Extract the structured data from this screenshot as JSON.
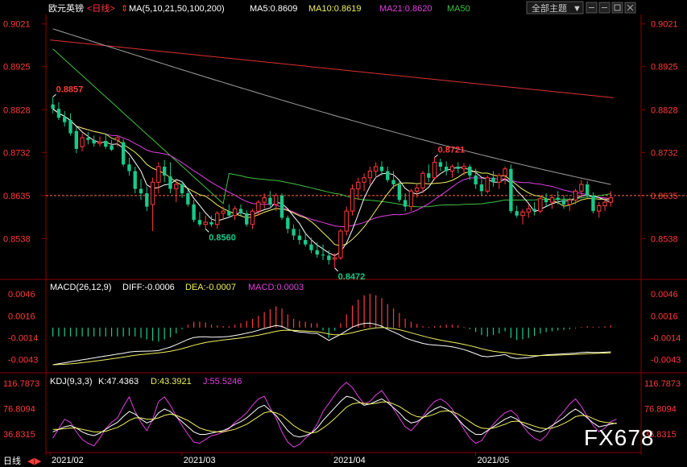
{
  "header": {
    "symbol": "欧元英镑",
    "period_tag": "<日线>",
    "ma_label": "MA(5,10,21,50,100,200)",
    "ma5": "MA5:0.8609",
    "ma10": "MA10:0.8619",
    "ma21": "MA21:0.8620",
    "ma50": "MA50",
    "theme_button": "全部主题",
    "theme_arrow": "▼"
  },
  "colors": {
    "up": "#ff3b3b",
    "down": "#19c98a",
    "price_label": "#ff3b3b",
    "ma5": "#ffffff",
    "ma10": "#f0f060",
    "ma21": "#e040e0",
    "ma50": "#40c040",
    "ma100": "#a0a0a0",
    "ma200": "#e03030",
    "grid": "#8b0000",
    "macd_label": "#ffffff",
    "dea": "#f0f060",
    "macdc": "#e040e0"
  },
  "price_axis": {
    "ticks": [
      "0.9021",
      "0.8925",
      "0.8828",
      "0.8732",
      "0.8635",
      "0.8538"
    ],
    "current_level": 0.8635,
    "annotations": [
      {
        "text": "0.8857",
        "value": 0.8857,
        "color": "#ff3b3b"
      },
      {
        "text": "0.8721",
        "value": 0.8721,
        "color": "#ff3b3b"
      },
      {
        "text": "0.8560",
        "value": 0.856,
        "color": "#19c98a"
      },
      {
        "text": "0.8472",
        "value": 0.8472,
        "color": "#19c98a"
      }
    ]
  },
  "macd": {
    "title": "MACD(26,12,9)",
    "diff": "DIFF:-0.0006",
    "dea": "DEA:-0.0007",
    "macd": "MACD:0.0003",
    "ticks": [
      "0.0046",
      "0.0016",
      "-0.0014",
      "-0.0043"
    ]
  },
  "kdj": {
    "title": "KDJ(9,3,3)",
    "k": "K:47.4363",
    "d": "D:43.3921",
    "j": "J:55.5246",
    "ticks": [
      "116.7873",
      "76.8094",
      "36.8315"
    ],
    "right_ticks": [
      "116.7873",
      "76.8094",
      "36.8315"
    ]
  },
  "time_axis": {
    "labels": [
      "2021/02",
      "2021/03",
      "2021/04",
      "2021/05"
    ]
  },
  "footer": {
    "period_button": "日线",
    "watermark": "FX678"
  },
  "chart_data": {
    "type": "candlestick",
    "instrument": "欧元英镑",
    "period": "日线",
    "price_range": [
      0.845,
      0.9035
    ],
    "candles": [
      {
        "o": 0.884,
        "h": 0.8857,
        "l": 0.882,
        "c": 0.883
      },
      {
        "o": 0.883,
        "h": 0.8845,
        "l": 0.8805,
        "c": 0.881
      },
      {
        "o": 0.8812,
        "h": 0.8825,
        "l": 0.879,
        "c": 0.88
      },
      {
        "o": 0.8805,
        "h": 0.882,
        "l": 0.877,
        "c": 0.8775
      },
      {
        "o": 0.878,
        "h": 0.879,
        "l": 0.873,
        "c": 0.874
      },
      {
        "o": 0.8745,
        "h": 0.8775,
        "l": 0.8735,
        "c": 0.8765
      },
      {
        "o": 0.8765,
        "h": 0.8778,
        "l": 0.875,
        "c": 0.876
      },
      {
        "o": 0.876,
        "h": 0.877,
        "l": 0.8745,
        "c": 0.8752
      },
      {
        "o": 0.8752,
        "h": 0.8768,
        "l": 0.8745,
        "c": 0.8755
      },
      {
        "o": 0.8758,
        "h": 0.8775,
        "l": 0.874,
        "c": 0.8745
      },
      {
        "o": 0.8748,
        "h": 0.876,
        "l": 0.8735,
        "c": 0.8738
      },
      {
        "o": 0.876,
        "h": 0.877,
        "l": 0.8745,
        "c": 0.8765
      },
      {
        "o": 0.8755,
        "h": 0.8762,
        "l": 0.87,
        "c": 0.8705
      },
      {
        "o": 0.8705,
        "h": 0.872,
        "l": 0.868,
        "c": 0.869
      },
      {
        "o": 0.869,
        "h": 0.87,
        "l": 0.864,
        "c": 0.865
      },
      {
        "o": 0.865,
        "h": 0.8672,
        "l": 0.8625,
        "c": 0.864
      },
      {
        "o": 0.864,
        "h": 0.8655,
        "l": 0.86,
        "c": 0.861
      },
      {
        "o": 0.8615,
        "h": 0.8675,
        "l": 0.8555,
        "c": 0.8665
      },
      {
        "o": 0.8665,
        "h": 0.871,
        "l": 0.864,
        "c": 0.87
      },
      {
        "o": 0.87,
        "h": 0.8715,
        "l": 0.8665,
        "c": 0.868
      },
      {
        "o": 0.8678,
        "h": 0.871,
        "l": 0.864,
        "c": 0.865
      },
      {
        "o": 0.865,
        "h": 0.867,
        "l": 0.862,
        "c": 0.866
      },
      {
        "o": 0.866,
        "h": 0.8668,
        "l": 0.863,
        "c": 0.864
      },
      {
        "o": 0.864,
        "h": 0.8648,
        "l": 0.861,
        "c": 0.8615
      },
      {
        "o": 0.8615,
        "h": 0.8625,
        "l": 0.8575,
        "c": 0.858
      },
      {
        "o": 0.858,
        "h": 0.8598,
        "l": 0.8565,
        "c": 0.857
      },
      {
        "o": 0.857,
        "h": 0.859,
        "l": 0.856,
        "c": 0.8575
      },
      {
        "o": 0.8575,
        "h": 0.859,
        "l": 0.8565,
        "c": 0.857
      },
      {
        "o": 0.857,
        "h": 0.86,
        "l": 0.856,
        "c": 0.8595
      },
      {
        "o": 0.8595,
        "h": 0.861,
        "l": 0.858,
        "c": 0.86
      },
      {
        "o": 0.86,
        "h": 0.8615,
        "l": 0.8585,
        "c": 0.859
      },
      {
        "o": 0.859,
        "h": 0.8612,
        "l": 0.858,
        "c": 0.8605
      },
      {
        "o": 0.8605,
        "h": 0.8615,
        "l": 0.859,
        "c": 0.8595
      },
      {
        "o": 0.8595,
        "h": 0.8602,
        "l": 0.8565,
        "c": 0.857
      },
      {
        "o": 0.857,
        "h": 0.8605,
        "l": 0.856,
        "c": 0.86
      },
      {
        "o": 0.86,
        "h": 0.8625,
        "l": 0.859,
        "c": 0.862
      },
      {
        "o": 0.862,
        "h": 0.864,
        "l": 0.8605,
        "c": 0.863
      },
      {
        "o": 0.863,
        "h": 0.8645,
        "l": 0.861,
        "c": 0.8615
      },
      {
        "o": 0.8615,
        "h": 0.864,
        "l": 0.86,
        "c": 0.8635
      },
      {
        "o": 0.8635,
        "h": 0.864,
        "l": 0.858,
        "c": 0.8585
      },
      {
        "o": 0.8585,
        "h": 0.859,
        "l": 0.855,
        "c": 0.856
      },
      {
        "o": 0.856,
        "h": 0.857,
        "l": 0.8535,
        "c": 0.8545
      },
      {
        "o": 0.8545,
        "h": 0.856,
        "l": 0.8525,
        "c": 0.8535
      },
      {
        "o": 0.8535,
        "h": 0.855,
        "l": 0.852,
        "c": 0.8525
      },
      {
        "o": 0.8525,
        "h": 0.854,
        "l": 0.8505,
        "c": 0.8512
      },
      {
        "o": 0.8512,
        "h": 0.853,
        "l": 0.8495,
        "c": 0.8502
      },
      {
        "o": 0.8502,
        "h": 0.8525,
        "l": 0.849,
        "c": 0.85
      },
      {
        "o": 0.85,
        "h": 0.8512,
        "l": 0.848,
        "c": 0.849
      },
      {
        "o": 0.8492,
        "h": 0.8505,
        "l": 0.8472,
        "c": 0.8495
      },
      {
        "o": 0.8495,
        "h": 0.856,
        "l": 0.849,
        "c": 0.8555
      },
      {
        "o": 0.8555,
        "h": 0.861,
        "l": 0.8545,
        "c": 0.86
      },
      {
        "o": 0.86,
        "h": 0.866,
        "l": 0.859,
        "c": 0.865
      },
      {
        "o": 0.865,
        "h": 0.8675,
        "l": 0.8625,
        "c": 0.8665
      },
      {
        "o": 0.8665,
        "h": 0.8685,
        "l": 0.8645,
        "c": 0.8675
      },
      {
        "o": 0.8675,
        "h": 0.87,
        "l": 0.866,
        "c": 0.869
      },
      {
        "o": 0.869,
        "h": 0.871,
        "l": 0.8675,
        "c": 0.87
      },
      {
        "o": 0.87,
        "h": 0.8712,
        "l": 0.868,
        "c": 0.869
      },
      {
        "o": 0.869,
        "h": 0.87,
        "l": 0.8665,
        "c": 0.867
      },
      {
        "o": 0.867,
        "h": 0.869,
        "l": 0.865,
        "c": 0.866
      },
      {
        "o": 0.866,
        "h": 0.8668,
        "l": 0.862,
        "c": 0.8625
      },
      {
        "o": 0.8625,
        "h": 0.864,
        "l": 0.86,
        "c": 0.861
      },
      {
        "o": 0.861,
        "h": 0.865,
        "l": 0.86,
        "c": 0.8645
      },
      {
        "o": 0.8645,
        "h": 0.866,
        "l": 0.863,
        "c": 0.8652
      },
      {
        "o": 0.8652,
        "h": 0.869,
        "l": 0.864,
        "c": 0.8685
      },
      {
        "o": 0.8685,
        "h": 0.8705,
        "l": 0.8665,
        "c": 0.8675
      },
      {
        "o": 0.8675,
        "h": 0.8721,
        "l": 0.867,
        "c": 0.871
      },
      {
        "o": 0.871,
        "h": 0.8718,
        "l": 0.869,
        "c": 0.87
      },
      {
        "o": 0.87,
        "h": 0.8712,
        "l": 0.868,
        "c": 0.869
      },
      {
        "o": 0.869,
        "h": 0.8705,
        "l": 0.8675,
        "c": 0.87
      },
      {
        "o": 0.87,
        "h": 0.871,
        "l": 0.8685,
        "c": 0.8695
      },
      {
        "o": 0.8695,
        "h": 0.8708,
        "l": 0.868,
        "c": 0.87
      },
      {
        "o": 0.87,
        "h": 0.8705,
        "l": 0.867,
        "c": 0.868
      },
      {
        "o": 0.868,
        "h": 0.8695,
        "l": 0.865,
        "c": 0.866
      },
      {
        "o": 0.866,
        "h": 0.8672,
        "l": 0.8635,
        "c": 0.8645
      },
      {
        "o": 0.8645,
        "h": 0.868,
        "l": 0.864,
        "c": 0.8675
      },
      {
        "o": 0.8675,
        "h": 0.869,
        "l": 0.8655,
        "c": 0.8665
      },
      {
        "o": 0.8665,
        "h": 0.8685,
        "l": 0.865,
        "c": 0.868
      },
      {
        "o": 0.868,
        "h": 0.87,
        "l": 0.866,
        "c": 0.8695
      },
      {
        "o": 0.8695,
        "h": 0.8705,
        "l": 0.8595,
        "c": 0.86
      },
      {
        "o": 0.86,
        "h": 0.8612,
        "l": 0.8585,
        "c": 0.859
      },
      {
        "o": 0.859,
        "h": 0.8605,
        "l": 0.857,
        "c": 0.8598
      },
      {
        "o": 0.8598,
        "h": 0.8615,
        "l": 0.8585,
        "c": 0.8605
      },
      {
        "o": 0.8605,
        "h": 0.862,
        "l": 0.859,
        "c": 0.86
      },
      {
        "o": 0.86,
        "h": 0.8635,
        "l": 0.8595,
        "c": 0.8628
      },
      {
        "o": 0.8628,
        "h": 0.864,
        "l": 0.861,
        "c": 0.862
      },
      {
        "o": 0.862,
        "h": 0.8638,
        "l": 0.8605,
        "c": 0.863
      },
      {
        "o": 0.863,
        "h": 0.8645,
        "l": 0.8615,
        "c": 0.8625
      },
      {
        "o": 0.8625,
        "h": 0.8635,
        "l": 0.8605,
        "c": 0.8615
      },
      {
        "o": 0.8615,
        "h": 0.863,
        "l": 0.86,
        "c": 0.8625
      },
      {
        "o": 0.8625,
        "h": 0.865,
        "l": 0.8615,
        "c": 0.8645
      },
      {
        "o": 0.8645,
        "h": 0.867,
        "l": 0.863,
        "c": 0.866
      },
      {
        "o": 0.866,
        "h": 0.8668,
        "l": 0.863,
        "c": 0.8635
      },
      {
        "o": 0.8635,
        "h": 0.8642,
        "l": 0.8595,
        "c": 0.86
      },
      {
        "o": 0.86,
        "h": 0.862,
        "l": 0.8585,
        "c": 0.8612
      },
      {
        "o": 0.8612,
        "h": 0.863,
        "l": 0.86,
        "c": 0.862
      },
      {
        "o": 0.862,
        "h": 0.8645,
        "l": 0.861,
        "c": 0.863
      }
    ],
    "ma_lines": {
      "ma100": {
        "start": 0.901,
        "end": 0.866
      },
      "ma200": {
        "start": 0.8985,
        "end": 0.8855
      }
    },
    "macd_hist": [
      -0.0012,
      -0.0012,
      -0.0012,
      -0.0012,
      -0.0012,
      -0.0012,
      -0.0012,
      -0.0012,
      -0.0012,
      -0.0012,
      -0.0012,
      -0.0012,
      -0.0012,
      -0.0011,
      -0.0012,
      -0.0014,
      -0.0016,
      -0.0018,
      -0.0019,
      -0.0016,
      -0.0013,
      -0.0008,
      -0.0002,
      0.0004,
      0.0008,
      0.0008,
      0.0007,
      0.0004,
      0.0003,
      0.0002,
      0.0002,
      0.0004,
      0.0006,
      0.0009,
      0.0012,
      0.0016,
      0.0021,
      0.0025,
      0.0029,
      0.0026,
      0.0018,
      0.0012,
      0.0009,
      0.0008,
      0.0006,
      0.0006,
      -0.0004,
      -0.0014,
      -0.0004,
      0.0006,
      0.0018,
      0.003,
      0.0038,
      0.0044,
      0.0046,
      0.0044,
      0.004,
      0.0032,
      0.0026,
      0.002,
      0.0012,
      0.0008,
      0.0005,
      0.0002,
      0.0001,
      0.0002,
      0.0003,
      0.0004,
      0.0004,
      0.0003,
      0.0001,
      -0.0002,
      -0.0006,
      -0.001,
      -0.0012,
      -0.001,
      -0.0008,
      -0.0005,
      -0.0014,
      -0.0017,
      -0.0016,
      -0.0014,
      -0.0011,
      -0.0008,
      -0.0006,
      -0.0005,
      -0.0004,
      -0.0003,
      -0.0002,
      -0.0001,
      0.0001,
      0.0002,
      0.0001,
      0.0001,
      0.0002,
      0.0003
    ],
    "macd_range": [
      -0.0058,
      0.006
    ],
    "kdj_range": [
      10,
      128
    ],
    "kdj_j": [
      30,
      45,
      60,
      55,
      40,
      28,
      22,
      18,
      30,
      45,
      55,
      62,
      80,
      95,
      72,
      55,
      42,
      60,
      88,
      95,
      82,
      65,
      50,
      36,
      24,
      22,
      28,
      34,
      36,
      40,
      45,
      55,
      62,
      70,
      82,
      92,
      96,
      78,
      62,
      40,
      24,
      16,
      20,
      30,
      38,
      52,
      72,
      85,
      98,
      110,
      118,
      110,
      96,
      84,
      88,
      98,
      105,
      92,
      76,
      62,
      48,
      42,
      52,
      64,
      78,
      88,
      92,
      86,
      76,
      60,
      44,
      30,
      22,
      26,
      40,
      52,
      62,
      70,
      74,
      66,
      50,
      38,
      30,
      26,
      34,
      48,
      62,
      72,
      84,
      92,
      80,
      64,
      50,
      40,
      46,
      56,
      60
    ],
    "kdj_k": [
      40,
      44,
      48,
      50,
      46,
      40,
      36,
      34,
      38,
      44,
      50,
      55,
      64,
      72,
      68,
      60,
      54,
      58,
      70,
      76,
      72,
      64,
      56,
      48,
      40,
      36,
      36,
      38,
      40,
      42,
      46,
      52,
      56,
      62,
      70,
      78,
      82,
      74,
      66,
      54,
      42,
      34,
      32,
      34,
      38,
      46,
      58,
      68,
      78,
      88,
      96,
      94,
      88,
      82,
      84,
      88,
      92,
      86,
      78,
      70,
      60,
      54,
      56,
      62,
      70,
      76,
      80,
      76,
      70,
      60,
      50,
      42,
      36,
      36,
      42,
      48,
      54,
      60,
      64,
      60,
      52,
      46,
      42,
      40,
      44,
      50,
      56,
      62,
      70,
      76,
      70,
      62,
      54,
      48,
      50,
      52,
      54
    ],
    "kdj_d": [
      44,
      44,
      45,
      46,
      46,
      44,
      42,
      40,
      40,
      41,
      44,
      47,
      52,
      58,
      62,
      62,
      60,
      60,
      62,
      66,
      68,
      66,
      62,
      58,
      52,
      46,
      43,
      41,
      40,
      40,
      42,
      44,
      48,
      52,
      58,
      64,
      70,
      72,
      70,
      66,
      58,
      50,
      44,
      40,
      38,
      40,
      46,
      53,
      61,
      70,
      79,
      84,
      86,
      85,
      84,
      85,
      87,
      87,
      84,
      80,
      74,
      68,
      64,
      63,
      65,
      68,
      72,
      73,
      72,
      68,
      62,
      56,
      50,
      46,
      45,
      46,
      49,
      52,
      56,
      57,
      55,
      52,
      49,
      46,
      45,
      46,
      49,
      53,
      58,
      64,
      66,
      65,
      61,
      57,
      55,
      54,
      53
    ]
  }
}
